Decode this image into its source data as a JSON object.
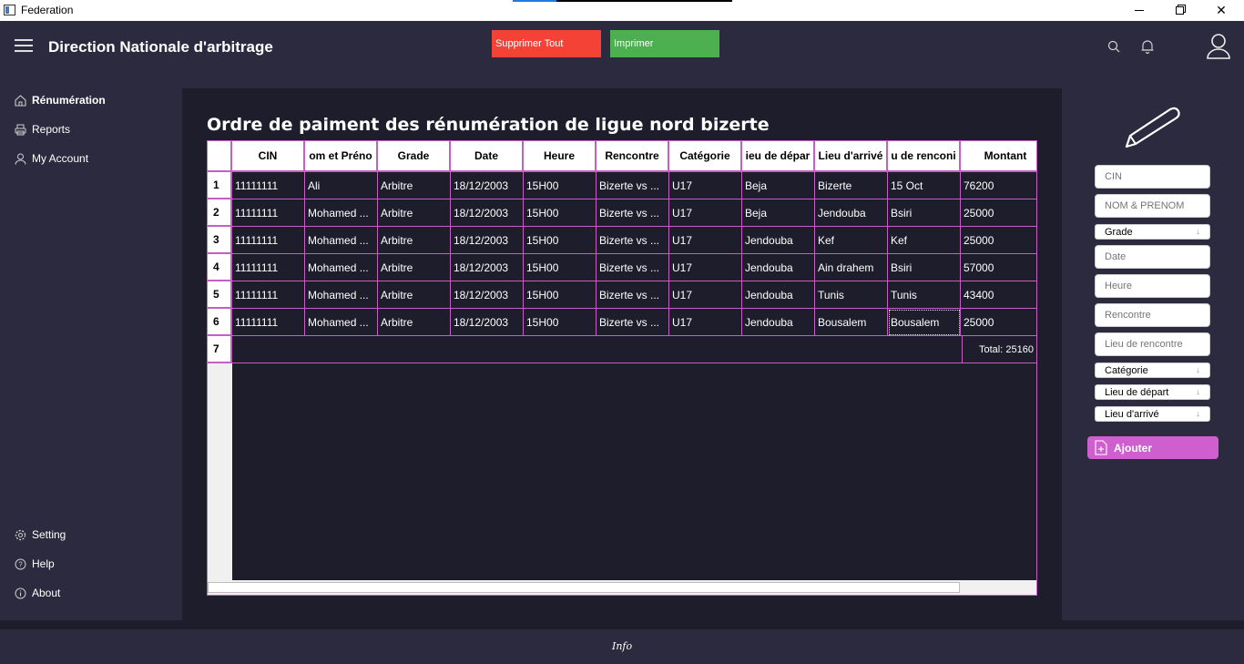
{
  "window": {
    "title": "Federation",
    "load_progress": 0.2
  },
  "header": {
    "title": "Direction Nationale d'arbitrage",
    "delete_all_label": "Supprimer Tout",
    "print_label": "Imprimer",
    "icons": [
      "menu-icon",
      "search-icon",
      "bell-icon",
      "user-icon"
    ]
  },
  "sidebar": {
    "items": [
      {
        "label": "Rénumération",
        "icon": "home-icon",
        "active": true
      },
      {
        "label": "Reports",
        "icon": "printer-icon",
        "active": false
      },
      {
        "label": "My Account",
        "icon": "user-icon",
        "active": false
      }
    ],
    "bottom_items": [
      {
        "label": "Setting",
        "icon": "gear-icon"
      },
      {
        "label": "Help",
        "icon": "help-icon"
      },
      {
        "label": "About",
        "icon": "info-icon"
      }
    ]
  },
  "main": {
    "title": "Ordre de paiment des rénumération de ligue nord bizerte",
    "table": {
      "columns": [
        "CIN",
        "om et Préno",
        "Grade",
        "Date",
        "Heure",
        "Rencontre",
        "Catégorie",
        "ieu de dépar",
        "Lieu d'arrivé",
        "u de renconi",
        "Montant"
      ],
      "row_numbers": [
        "1",
        "2",
        "3",
        "4",
        "5",
        "6",
        "7"
      ],
      "rows": [
        [
          "11111111",
          "Ali",
          "Arbitre",
          "18/12/2003",
          "15H00",
          "Bizerte vs ...",
          "U17",
          "Beja",
          "Bizerte",
          "15 Oct",
          "76200"
        ],
        [
          "11111111",
          "Mohamed ...",
          "Arbitre",
          "18/12/2003",
          "15H00",
          "Bizerte vs ...",
          "U17",
          "Beja",
          "Jendouba",
          "Bsiri",
          "25000"
        ],
        [
          "11111111",
          "Mohamed ...",
          "Arbitre",
          "18/12/2003",
          "15H00",
          "Bizerte vs ...",
          "U17",
          "Jendouba",
          "Kef",
          "Kef",
          "25000"
        ],
        [
          "11111111",
          "Mohamed ...",
          "Arbitre",
          "18/12/2003",
          "15H00",
          "Bizerte vs ...",
          "U17",
          "Jendouba",
          "Ain drahem",
          "Bsiri",
          "57000"
        ],
        [
          "11111111",
          "Mohamed ...",
          "Arbitre",
          "18/12/2003",
          "15H00",
          "Bizerte vs ...",
          "U17",
          "Jendouba",
          "Tunis",
          "Tunis",
          "43400"
        ],
        [
          "11111111",
          "Mohamed ...",
          "Arbitre",
          "18/12/2003",
          "15H00",
          "Bizerte vs ...",
          "U17",
          "Jendouba",
          "Bousalem",
          "Bousalem",
          "25000"
        ]
      ],
      "total": "Total: 25160"
    }
  },
  "form": {
    "cin_placeholder": "CIN",
    "nom_placeholder": "NOM & PRENOM",
    "grade_select": "Grade",
    "date_placeholder": "Date",
    "heure_placeholder": "Heure",
    "rencontre_placeholder": "Rencontre",
    "lieu_rencontre_placeholder": "Lieu de rencontre",
    "categorie_select": "Catégorie",
    "lieu_depart_select": "Lieu de départ",
    "lieu_arrive_select": "Lieu d'arrivé",
    "add_label": "Ajouter"
  },
  "footer": {
    "info_label": "Info"
  },
  "colors": {
    "background": "#2b2a3f",
    "content_bg": "#1e1d2c",
    "grid_border": "#c65ec6",
    "delete_button": "#f44336",
    "print_button": "#4caf50",
    "add_button": "#cf5fcf"
  }
}
